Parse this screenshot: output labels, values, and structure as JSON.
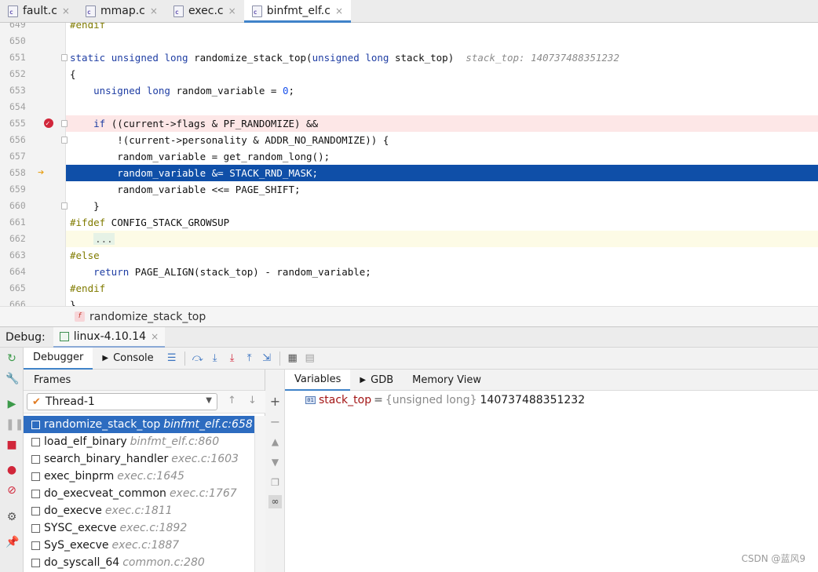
{
  "tabs": [
    {
      "label": "fault.c",
      "active": false
    },
    {
      "label": "mmap.c",
      "active": false
    },
    {
      "label": "exec.c",
      "active": false
    },
    {
      "label": "binfmt_elf.c",
      "active": true
    }
  ],
  "tab_close_glyph": "×",
  "file_icon_letter": "c",
  "editor": {
    "lines": [
      {
        "num": "649",
        "code": "#endif"
      },
      {
        "num": "650",
        "code": ""
      },
      {
        "num": "651",
        "code": "static unsigned long randomize_stack_top(unsigned long stack_top)",
        "hint": "stack_top: 140737488351232"
      },
      {
        "num": "652",
        "code": "{"
      },
      {
        "num": "653",
        "code": "    unsigned long random_variable = 0;"
      },
      {
        "num": "654",
        "code": ""
      },
      {
        "num": "655",
        "code": "    if ((current->flags & PF_RANDOMIZE) &&",
        "state": "breakpoint"
      },
      {
        "num": "656",
        "code": "        !(current->personality & ADDR_NO_RANDOMIZE)) {"
      },
      {
        "num": "657",
        "code": "        random_variable = get_random_long();"
      },
      {
        "num": "658",
        "code": "        random_variable &= STACK_RND_MASK;",
        "state": "execution"
      },
      {
        "num": "659",
        "code": "        random_variable <<= PAGE_SHIFT;"
      },
      {
        "num": "660",
        "code": "    }"
      },
      {
        "num": "661",
        "code": "#ifdef CONFIG_STACK_GROWSUP"
      },
      {
        "num": "662",
        "code": "    ...",
        "state": "current"
      },
      {
        "num": "663",
        "code": "#else"
      },
      {
        "num": "664",
        "code": "    return PAGE_ALIGN(stack_top) - random_variable;"
      },
      {
        "num": "665",
        "code": "#endif"
      },
      {
        "num": "666",
        "code": "}"
      }
    ]
  },
  "breadcrumb": {
    "badge": "f",
    "label": "randomize_stack_top"
  },
  "debug": {
    "label": "Debug:",
    "session": "linux-4.10.14",
    "session_close": "×",
    "tabs": {
      "debugger": "Debugger",
      "console": "Console"
    }
  },
  "frames": {
    "title": "Frames",
    "thread": "Thread-1",
    "nav_up": "↑",
    "nav_down": "↓",
    "items": [
      {
        "func": "randomize_stack_top",
        "loc": "binfmt_elf.c:658",
        "selected": true
      },
      {
        "func": "load_elf_binary",
        "loc": "binfmt_elf.c:860"
      },
      {
        "func": "search_binary_handler",
        "loc": "exec.c:1603"
      },
      {
        "func": "exec_binprm",
        "loc": "exec.c:1645"
      },
      {
        "func": "do_execveat_common",
        "loc": "exec.c:1767"
      },
      {
        "func": "do_execve",
        "loc": "exec.c:1811"
      },
      {
        "func": "SYSC_execve",
        "loc": "exec.c:1892"
      },
      {
        "func": "SyS_execve",
        "loc": "exec.c:1887"
      },
      {
        "func": "do_syscall_64",
        "loc": "common.c:280"
      }
    ]
  },
  "variables": {
    "tabs": [
      "Variables",
      "GDB",
      "Memory View"
    ],
    "items": [
      {
        "badge": "01",
        "name": "stack_top",
        "eq": "=",
        "type": "{unsigned long}",
        "value": "140737488351232"
      }
    ]
  },
  "watermark": "CSDN @蓝风9",
  "colors": {
    "execution_line": "#0f4fa8",
    "breakpoint_line": "#fde7e7",
    "selected_frame": "#2d6cc0",
    "keyword": "#1e3da3",
    "preprocessor": "#807b00",
    "variable_name": "#a31515"
  },
  "icons": {
    "left_strip": [
      "rerun-icon",
      "settings-wrench-icon",
      "resume-icon",
      "pause-icon",
      "stop-icon",
      "view-breakpoints-icon",
      "mute-breakpoints-icon",
      "gear-icon",
      "pin-icon"
    ],
    "toolbar": [
      "console-menu-icon",
      "step-over-icon",
      "step-into-icon",
      "force-step-into-icon",
      "step-out-icon",
      "run-to-cursor-icon",
      "evaluate-expression-icon",
      "restore-layout-icon"
    ],
    "variables_side": [
      "add-watch-icon",
      "remove-watch-icon",
      "move-up-icon",
      "move-down-icon",
      "copy-icon",
      "show-watches-icon"
    ]
  }
}
